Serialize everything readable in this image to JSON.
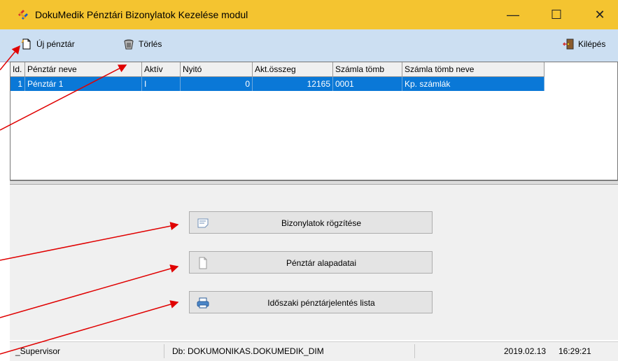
{
  "window": {
    "title": "DokuMedik Pénztári Bizonylatok Kezelése modul",
    "controls": {
      "minimize": "—",
      "maximize": "☐",
      "close": "✕"
    }
  },
  "toolbar": {
    "new_cashdesk": "Új pénztár",
    "delete": "Törlés",
    "exit": "Kilépés"
  },
  "grid": {
    "columns": [
      "Id.",
      "Pénztár neve",
      "Aktív",
      "Nyitó",
      "Akt.összeg",
      "Számla tömb",
      "Számla tömb neve"
    ],
    "rows": [
      {
        "id": "1",
        "name": "Pénztár 1",
        "active": "I",
        "opening": "0",
        "current": "12165",
        "block": "0001",
        "block_name": "Kp. számlák"
      }
    ]
  },
  "actions": {
    "record_vouchers": "Bizonylatok rögzítése",
    "cashdesk_basics": "Pénztár alapadatai",
    "periodic_report": "Időszaki pénztárjelentés lista"
  },
  "status": {
    "user": "_Supervisor",
    "db": "Db: DOKUMONIKAS.DOKUMEDIK_DIM",
    "date": "2019.02.13",
    "time": "16:29:21"
  },
  "colors": {
    "titlebar": "#f4c430",
    "toolbar": "#ccdff2",
    "selection": "#0a78d7",
    "annotation": "#e00000"
  }
}
